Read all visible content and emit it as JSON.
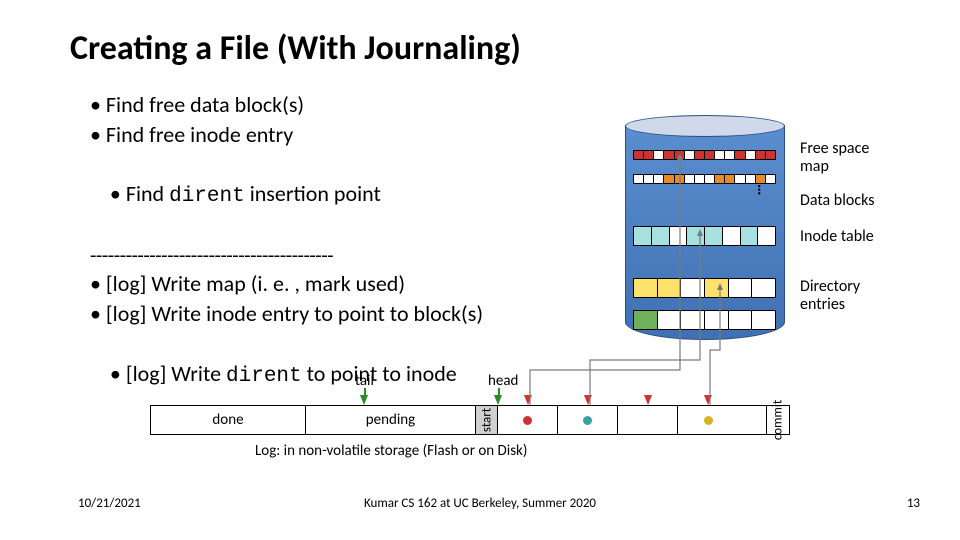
{
  "title": "Creating a File (With Journaling)",
  "bullets": {
    "b1": "• Find free data block(s)",
    "b2": "• Find free inode entry",
    "b3_pre": "• Find ",
    "b3_mono": "dirent",
    "b3_post": " insertion point",
    "sep": "-----------------------------------------",
    "b4": "• [log] Write map (i. e. , mark used)",
    "b5": "• [log] Write inode entry to point to block(s)",
    "b6_pre": "• [log] Write ",
    "b6_mono": "dirent",
    "b6_post": " to point to inode"
  },
  "disk_labels": {
    "free_space": "Free space\nmap",
    "data_blocks": "Data blocks",
    "inode_table": "Inode table",
    "directory": "Directory\nentries"
  },
  "ellipsis": "…",
  "log": {
    "tail": "tail",
    "head": "head",
    "done": "done",
    "pending": "pending",
    "start": "start",
    "commit": "commit",
    "caption": "Log: in non-volatile storage (Flash or on Disk)"
  },
  "footer": {
    "date": "10/21/2021",
    "mid": "Kumar CS 162 at UC Berkeley, Summer 2020",
    "page": "13"
  }
}
